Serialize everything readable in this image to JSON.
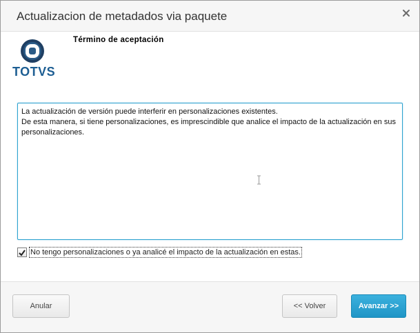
{
  "window": {
    "title": "Actualizacion de metadados via paquete"
  },
  "logo": {
    "wordmark": "TOTVS"
  },
  "section": {
    "title": "Término de aceptación"
  },
  "terms": {
    "line1": "La actualización de versión puede interferir en personalizaciones existentes.",
    "line2": "De esta manera, si tiene personalizaciones, es imprescindible que analice el impacto de la actualización en sus personalizaciones."
  },
  "accept": {
    "checked": true,
    "label": "No tengo personalizaciones o ya analicé el impacto de la actualización en estas."
  },
  "buttons": {
    "cancel": "Anular",
    "back": "<< Volver",
    "next": "Avanzar >>"
  },
  "colors": {
    "accent": "#1f95c6",
    "brand": "#1d5e93",
    "focus_border": "#2aa1cf"
  },
  "icons": {
    "close": "close-icon",
    "logo": "totvs-logo-icon",
    "check": "checkmark-icon",
    "cursor": "text-cursor-icon"
  }
}
